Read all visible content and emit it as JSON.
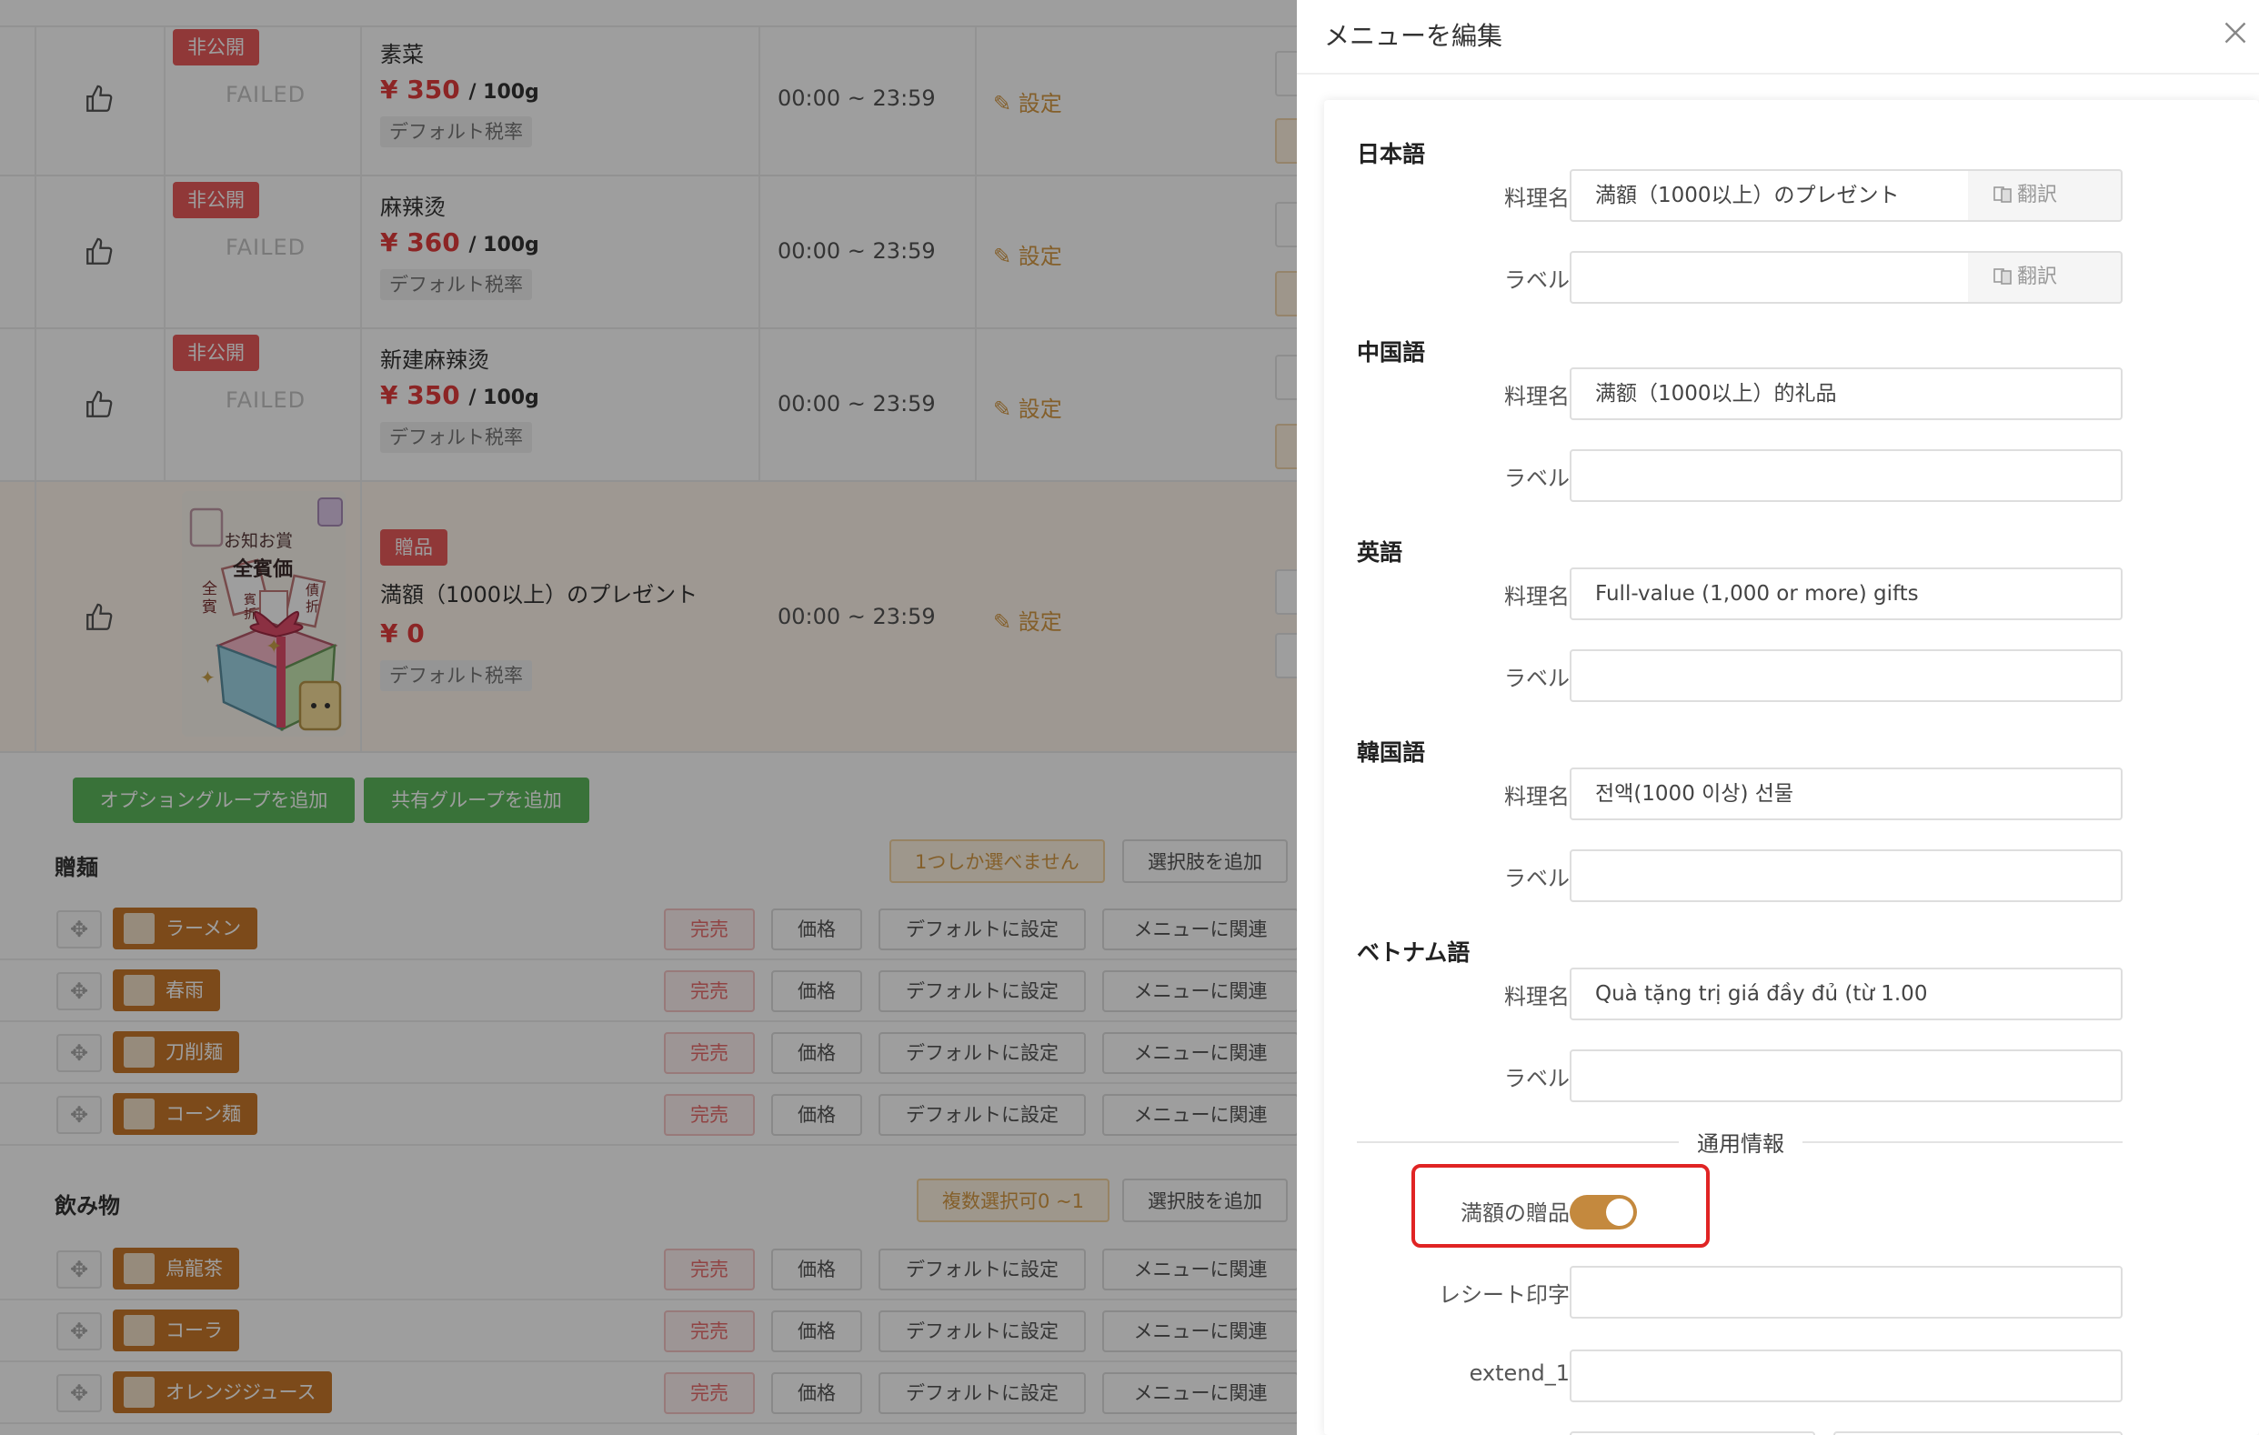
{
  "menu_rows": [
    {
      "badge": "非公開",
      "status": "FAILED",
      "name": "素菜",
      "price": "¥ 350",
      "unit": "/ 100g",
      "tax": "デフォルト税率",
      "time": "00:00 ~ 23:59",
      "setting": "設定"
    },
    {
      "badge": "非公開",
      "status": "FAILED",
      "name": "麻辣烫",
      "price": "¥ 360",
      "unit": "/ 100g",
      "tax": "デフォルト税率",
      "time": "00:00 ~ 23:59",
      "setting": "設定"
    },
    {
      "badge": "非公開",
      "status": "FAILED",
      "name": "新建麻辣烫",
      "price": "¥ 350",
      "unit": "/ 100g",
      "tax": "デフォルト税率",
      "time": "00:00 ~ 23:59",
      "setting": "設定"
    },
    {
      "badge": "贈品",
      "status": "",
      "name": "満額（1000以上）のプレゼント",
      "price": "¥ 0",
      "unit": "",
      "tax": "デフォルト税率",
      "time": "00:00 ~ 23:59",
      "setting": "設定"
    }
  ],
  "gift_image_text": {
    "top": "お知お賞",
    "main": "全賓価",
    "left": "全賓",
    "mid": "賓折",
    "right": "債折"
  },
  "buttons": {
    "add_option_group": "オプショングループを追加",
    "add_shared_group": "共有グループを追加"
  },
  "groups": [
    {
      "title": "贈麺",
      "rule": "1つしか選べません",
      "add_choice": "選択肢を追加",
      "items": [
        "ラーメン",
        "春雨",
        "刀削麺",
        "コーン麺"
      ]
    },
    {
      "title": "飲み物",
      "rule": "複数選択可0 ~1",
      "add_choice": "選択肢を追加",
      "items": [
        "烏龍茶",
        "コーラ",
        "オレンジジュース"
      ]
    }
  ],
  "option_actions": {
    "sold_out": "完売",
    "price": "価格",
    "set_default": "デフォルトに設定",
    "link_menu": "メニューに関連"
  },
  "drawer": {
    "title": "メニューを編集",
    "translate_label": "翻訳",
    "languages": [
      {
        "title": "日本語",
        "name_label": "料理名",
        "name_value": "満額（1000以上）のプレゼント",
        "label_label": "ラベル",
        "label_value": "",
        "has_translate": true
      },
      {
        "title": "中国語",
        "name_label": "料理名",
        "name_value": "满额（1000以上）的礼品",
        "label_label": "ラベル",
        "label_value": "",
        "has_translate": false
      },
      {
        "title": "英語",
        "name_label": "料理名",
        "name_value": "Full-value (1,000 or more) gifts",
        "label_label": "ラベル",
        "label_value": "",
        "has_translate": false
      },
      {
        "title": "韓国語",
        "name_label": "料理名",
        "name_value": "전액(1000 이상) 선물",
        "label_label": "ラベル",
        "label_value": "",
        "has_translate": false
      },
      {
        "title": "ベトナム語",
        "name_label": "料理名",
        "name_value": "Quà tặng trị giá đầy đủ (từ 1.00",
        "label_label": "ラベル",
        "label_value": "",
        "has_translate": false
      }
    ],
    "common_section": "通用情報",
    "gift_toggle_label": "満額の贈品",
    "gift_toggle_on": true,
    "receipt_label": "レシート印字",
    "receipt_value": "",
    "extend_label": "extend_1",
    "extend_value": ""
  },
  "colors": {
    "accent": "#c4893e",
    "danger": "#e95b5b",
    "success": "#5cb85c",
    "highlight": "#e02424"
  }
}
